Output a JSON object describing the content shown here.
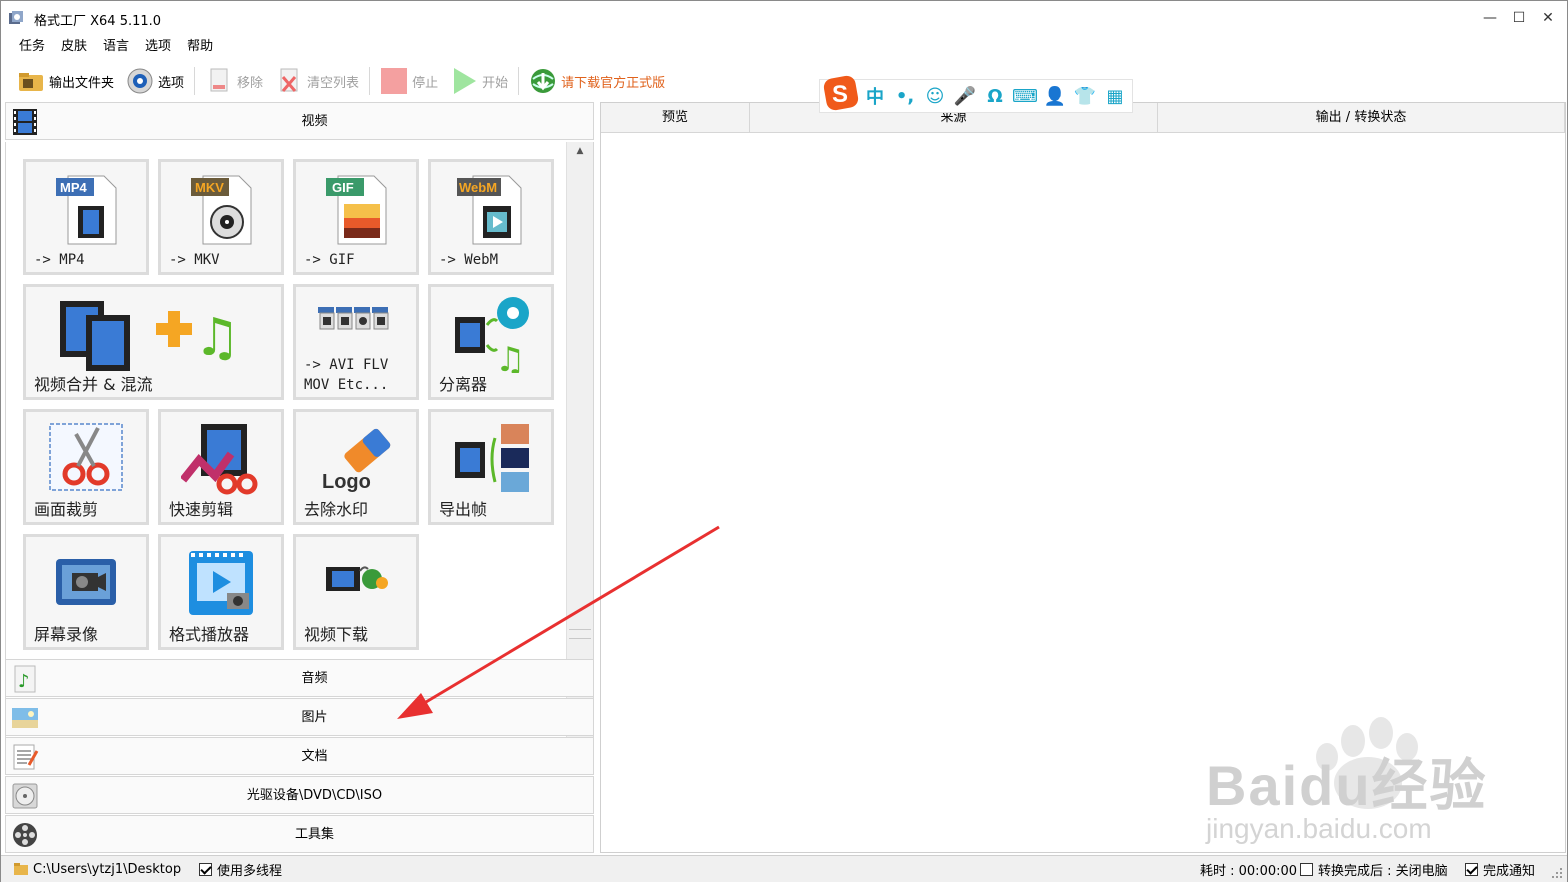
{
  "window": {
    "title": "格式工厂 X64 5.11.0",
    "controls": {
      "minimize": "—",
      "maximize": "☐",
      "close": "✕"
    }
  },
  "menu": [
    "任务",
    "皮肤",
    "语言",
    "选项",
    "帮助"
  ],
  "toolbar": {
    "output_folder": "输出文件夹",
    "options": "选项",
    "remove": "移除",
    "clear_list": "清空列表",
    "stop": "停止",
    "start": "开始",
    "download_official": "请下载官方正式版"
  },
  "ime": {
    "items": [
      "中",
      "•,",
      "☺",
      "🎤",
      "Ω",
      "⌨",
      "👤",
      "👕",
      "▦"
    ],
    "logo": "sogou-icon"
  },
  "categories": {
    "video": "视频",
    "audio": "音频",
    "image": "图片",
    "document": "文档",
    "optical": "光驱设备\\DVD\\CD\\ISO",
    "tools": "工具集"
  },
  "tiles": [
    {
      "label": "-> MP4",
      "badge": "MP4"
    },
    {
      "label": "-> MKV",
      "badge": "MKV"
    },
    {
      "label": "-> GIF",
      "badge": "GIF"
    },
    {
      "label": "-> WebM",
      "badge": "WebM"
    },
    {
      "label": "视频合并 & 混流"
    },
    {
      "label": "-> AVI FLV\nMOV Etc..."
    },
    {
      "label": "分离器"
    },
    {
      "label": "画面裁剪"
    },
    {
      "label": "快速剪辑"
    },
    {
      "label": "去除水印"
    },
    {
      "label": "导出帧"
    },
    {
      "label": "屏幕录像"
    },
    {
      "label": "格式播放器"
    },
    {
      "label": "视频下载"
    }
  ],
  "table": {
    "columns": [
      "预览",
      "来源",
      "输出 / 转换状态"
    ]
  },
  "status": {
    "path": "C:\\Users\\ytzj1\\Desktop",
    "multithread": "使用多线程",
    "elapsed": "耗时 : 00:00:00",
    "after_done": "转换完成后 : 关闭电脑",
    "notify": "完成通知"
  },
  "watermark": {
    "text": "Baidu经验",
    "sub": "jingyan.baidu.com"
  }
}
